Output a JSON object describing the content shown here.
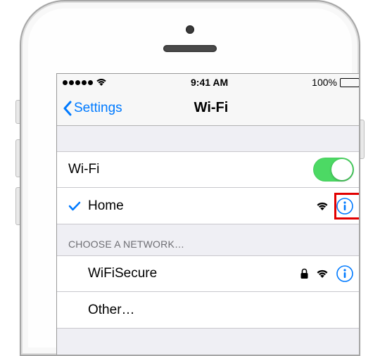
{
  "statusbar": {
    "signal_dots": 5,
    "time": "9:41 AM",
    "battery_pct": "100%"
  },
  "navbar": {
    "back_label": "Settings",
    "title": "Wi-Fi"
  },
  "wifi": {
    "toggle_label": "Wi-Fi",
    "toggle_on": true,
    "connected": {
      "name": "Home"
    }
  },
  "choose_header": "CHOOSE A NETWORK…",
  "networks": [
    {
      "name": "WiFiSecure",
      "locked": true
    }
  ],
  "other_label": "Other…",
  "highlighted_info_button": "connected-network-info"
}
